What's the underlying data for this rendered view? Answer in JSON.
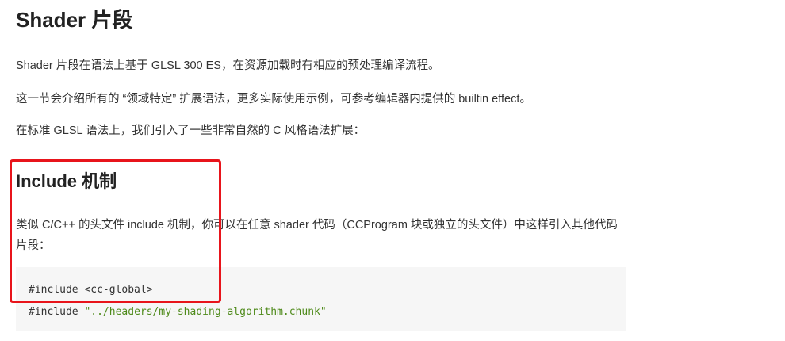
{
  "heading": "Shader 片段",
  "paragraphs": {
    "p1": "Shader 片段在语法上基于 GLSL 300 ES，在资源加载时有相应的预处理编译流程。",
    "p2": "这一节会介绍所有的 “领域特定” 扩展语法，更多实际使用示例，可参考编辑器内提供的 builtin effect。",
    "p3": "在标准 GLSL 语法上，我们引入了一些非常自然的 C 风格语法扩展："
  },
  "section": {
    "title": "Include 机制",
    "description": "类似 C/C++ 的头文件 include 机制，你可以在任意 shader 代码（CCProgram 块或独立的头文件）中这样引入其他代码片段：",
    "code": {
      "line1": "#include <cc-global>",
      "line2_keyword": "#include ",
      "line2_string": "\"../headers/my-shading-algorithm.chunk\""
    }
  },
  "colors": {
    "highlight": "#e8141b",
    "code_string": "#4e8a1a",
    "code_background": "#f6f6f6"
  }
}
